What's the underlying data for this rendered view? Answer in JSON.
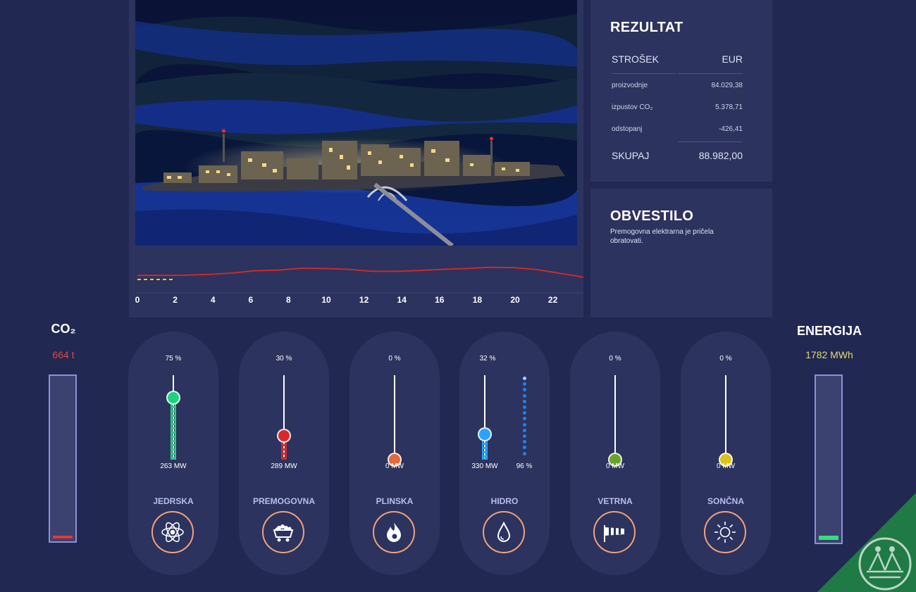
{
  "results": {
    "title": "REZULTAT",
    "header_label": "STROŠEK",
    "header_unit": "EUR",
    "rows": [
      {
        "label": "proizvodnje",
        "value": "84.029,38"
      },
      {
        "label": "izpustov CO₂",
        "value": "5.378,71"
      },
      {
        "label": "odstopanj",
        "value": "-426,41"
      }
    ],
    "total_label": "SKUPAJ",
    "total_value": "88.982,00"
  },
  "notice": {
    "title": "OBVESTILO",
    "text": "Premogovna elektrarna je pričela obratovati."
  },
  "timeline": {
    "tick_labels": [
      "0",
      "2",
      "4",
      "6",
      "8",
      "10",
      "12",
      "14",
      "16",
      "18",
      "20",
      "22"
    ],
    "line_color": "#cc2a2a",
    "marker_color": "#f0d000",
    "demand_profile": [
      0.31,
      0.31,
      0.32,
      0.36,
      0.43,
      0.55,
      0.58,
      0.68,
      0.66,
      0.62,
      0.52,
      0.52,
      0.56,
      0.62,
      0.66,
      0.72,
      0.71,
      0.61,
      0.42,
      0.22
    ]
  },
  "co2": {
    "title": "CO₂",
    "value": "664 t",
    "value_color": "#e04848",
    "bar_color": "#e03a3a"
  },
  "energy": {
    "title": "ENERGIJA",
    "value": "1782 MWh",
    "value_color": "#e6d870",
    "bar_color": "#33e07a"
  },
  "sources": [
    {
      "name": "JEDRSKA",
      "percent": "75 %",
      "power": "263 MW",
      "color": "#1fd27e",
      "icon": "atom-icon",
      "level": 0.75
    },
    {
      "name": "PREMOGOVNA",
      "percent": "30 %",
      "power": "289 MW",
      "color": "#d62a2a",
      "icon": "coal-cart-icon",
      "level": 0.3
    },
    {
      "name": "PLINSKA",
      "percent": "0 %",
      "power": "0 MW",
      "color": "#e06a3a",
      "icon": "flame-icon",
      "level": 0.0
    },
    {
      "name": "HIDRO",
      "percent": "32 %",
      "power": "330 MW",
      "color": "#2aa3ff",
      "icon": "water-drop-icon",
      "level": 0.32,
      "reservoir": "96 %"
    },
    {
      "name": "VETRNA",
      "percent": "0 %",
      "power": "0 MW",
      "color": "#6aa32a",
      "icon": "windsock-icon",
      "level": 0.0
    },
    {
      "name": "SONČNA",
      "percent": "0 %",
      "power": "0 MW",
      "color": "#d8c41a",
      "icon": "sun-icon",
      "level": 0.0
    }
  ]
}
